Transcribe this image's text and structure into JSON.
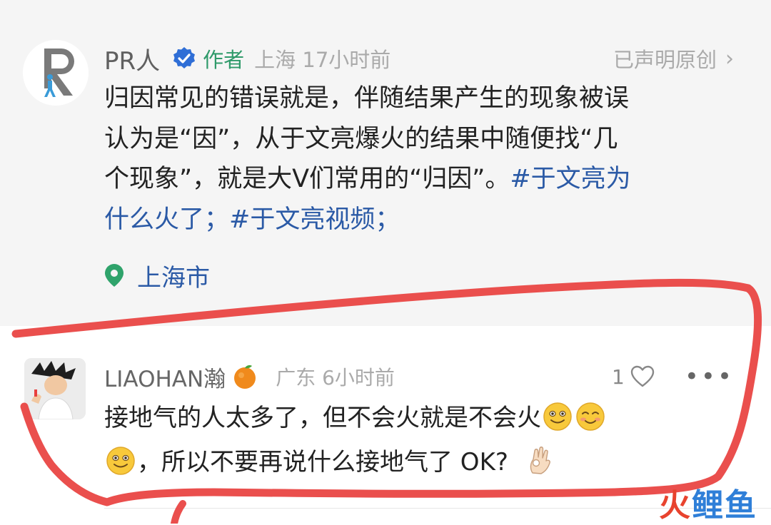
{
  "post": {
    "author": "PR人",
    "role_badge": "作者",
    "location_time": "上海 17小时前",
    "original_claim": "已声明原创",
    "body_lines": [
      [
        "归因常见的错误就是，伴随结果产生的现象被误"
      ],
      [
        "认为是“因”，从于文亮爆火的结果中随便找“几"
      ],
      [
        "个现象”，就是大V们常用的“归因”。",
        "#于文亮为"
      ],
      [
        "什么火了；#于文亮视频；"
      ]
    ],
    "location": "上海市"
  },
  "comment": {
    "username": "LIAOHAN瀚",
    "meta": "广东 6小时前",
    "like_count": "1",
    "more_label": "•••",
    "line1": "接地气的人太多了，但不会火就是不会火",
    "line2": "，所以不要再说什么接地气了 OK?"
  },
  "watermark": {
    "part1": "火",
    "part2": "鲤鱼"
  },
  "colors": {
    "post_bg": "#f5f5f5",
    "hashtag": "#2b5aa6",
    "author_role": "#2f9a6a",
    "verified": "#2f6ed6",
    "annotation_stroke": "#e8403e"
  },
  "icons": {
    "verified": "verified-check-icon",
    "location": "location-pin-icon",
    "chevron": "chevron-right-icon",
    "like": "heart-outline-icon",
    "more": "more-dots-icon",
    "badge": "orange-fruit-icon",
    "emoji_smile": "smile-emoji",
    "emoji_blush": "blush-emoji",
    "emoji_ok": "ok-hand-emoji"
  }
}
